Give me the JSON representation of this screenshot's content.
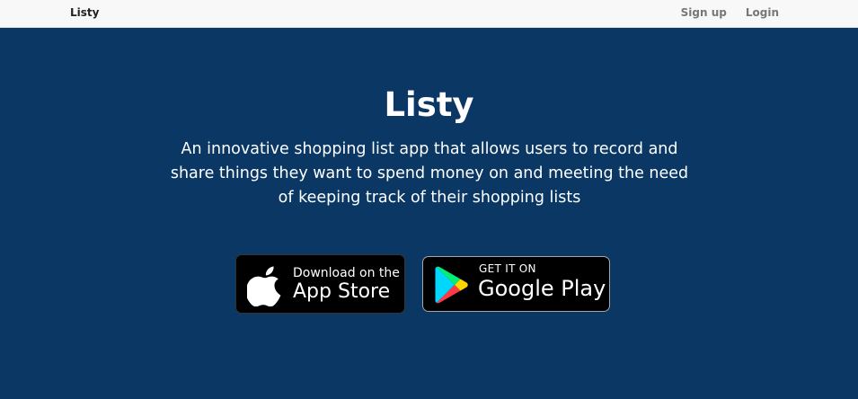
{
  "navbar": {
    "brand": "Listy",
    "links": [
      {
        "label": "Sign up"
      },
      {
        "label": "Login"
      }
    ]
  },
  "hero": {
    "title": "Listy",
    "description": "An innovative shopping list app that allows users to record and share things they want to spend money on and meeting the need of keeping track of their shopping lists"
  },
  "badges": {
    "app_store": {
      "line1": "Download on the",
      "line2": "App Store",
      "icon": "apple-icon"
    },
    "google_play": {
      "line1": "GET IT ON",
      "line2": "Google Play",
      "icon": "google-play-icon"
    }
  },
  "colors": {
    "hero_background": "#0a3764",
    "navbar_background": "#f8f8f8",
    "badge_background": "#000000",
    "hero_text": "#ffffff"
  }
}
